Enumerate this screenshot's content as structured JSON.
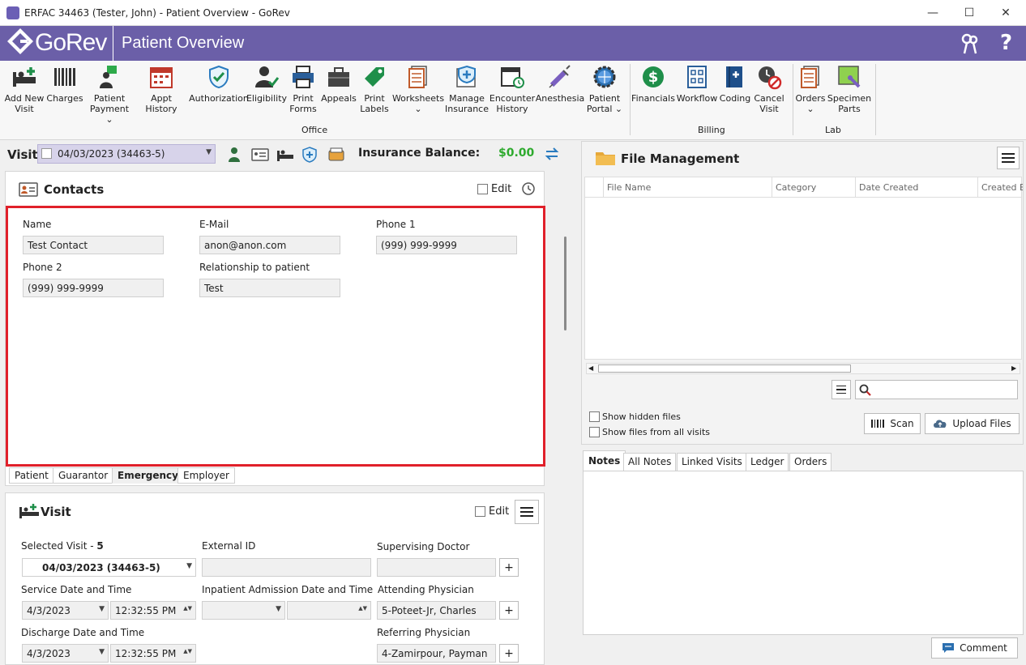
{
  "window": {
    "title": "ERFAC 34463 (Tester, John) - Patient Overview - GoRev",
    "minimize": "—",
    "maximize": "☐",
    "close": "✕"
  },
  "appbar": {
    "logo_text": "GoRev",
    "page_title": "Patient Overview",
    "keys_icon": "keys-icon",
    "help_icon": "?"
  },
  "ribbon": {
    "office_items": [
      {
        "label": "Add New\nVisit",
        "icon": "add-visit-icon"
      },
      {
        "label": "Charges",
        "icon": "barcode-icon"
      },
      {
        "label": "Patient\nPayment ⌄",
        "icon": "payment-icon"
      },
      {
        "label": "Appt History",
        "icon": "calendar-icon"
      },
      {
        "label": "Authorization",
        "icon": "shield-check-icon"
      },
      {
        "label": "Eligibility",
        "icon": "person-check-icon"
      },
      {
        "label": "Print\nForms",
        "icon": "printer-icon"
      },
      {
        "label": "Appeals",
        "icon": "briefcase-icon"
      },
      {
        "label": "Print\nLabels",
        "icon": "tag-icon"
      },
      {
        "label": "Worksheets\n⌄",
        "icon": "worksheets-icon"
      },
      {
        "label": "Manage\nInsurance",
        "icon": "insurance-icon"
      },
      {
        "label": "Encounter\nHistory",
        "icon": "encounter-icon"
      },
      {
        "label": "Anesthesia",
        "icon": "syringe-icon"
      },
      {
        "label": "Patient\nPortal ⌄",
        "icon": "globe-gear-icon"
      }
    ],
    "billing_items": [
      {
        "label": "Financials",
        "icon": "dollar-icon"
      },
      {
        "label": "Workflow",
        "icon": "workflow-icon"
      },
      {
        "label": "Coding",
        "icon": "coding-book-icon"
      },
      {
        "label": "Cancel\nVisit",
        "icon": "cancel-visit-icon"
      }
    ],
    "lab_items": [
      {
        "label": "Orders\n⌄",
        "icon": "orders-icon"
      },
      {
        "label": "Specimen\nParts",
        "icon": "specimen-icon"
      }
    ],
    "group_office": "Office",
    "group_billing": "Billing",
    "group_lab": "Lab"
  },
  "visitbar": {
    "label": "Visit",
    "selected": "04/03/2023 (34463-5)",
    "insurance_balance_label": "Insurance Balance:",
    "insurance_balance_value": "$0.00"
  },
  "contacts": {
    "title": "Contacts",
    "edit_label": "Edit",
    "name_label": "Name",
    "name_value": "Test Contact",
    "email_label": "E-Mail",
    "email_value": "anon@anon.com",
    "phone1_label": "Phone 1",
    "phone1_value": "(999) 999-9999",
    "phone2_label": "Phone 2",
    "phone2_value": "(999) 999-9999",
    "relationship_label": "Relationship to patient",
    "relationship_value": "Test",
    "tabs": [
      "Patient",
      "Guarantor",
      "Emergency",
      "Employer"
    ]
  },
  "visit": {
    "title": "Visit",
    "edit_label": "Edit",
    "selected_visit_label": "Selected Visit -",
    "selected_visit_num": "5",
    "selected_visit_value": "04/03/2023 (34463-5)",
    "external_id_label": "External ID",
    "supervising_doctor_label": "Supervising Doctor",
    "service_datetime_label": "Service Date and Time",
    "service_date": "4/3/2023",
    "service_time": "12:32:55 PM",
    "inpatient_label": "Inpatient Admission Date and Time",
    "attending_label": "Attending Physician",
    "attending_value": "5-Poteet-Jr, Charles",
    "discharge_label": "Discharge Date and Time",
    "discharge_date": "4/3/2023",
    "discharge_time": "12:32:55 PM",
    "referring_label": "Referring Physician",
    "referring_value": "4-Zamirpour, Payman"
  },
  "files": {
    "title": "File Management",
    "columns": [
      "File Name",
      "Category",
      "Date Created",
      "Created B"
    ],
    "show_hidden": "Show hidden files",
    "show_all_visits": "Show files from all visits",
    "scan_label": "Scan",
    "upload_label": "Upload Files"
  },
  "notes": {
    "tabs": [
      "Notes",
      "All Notes",
      "Linked Visits",
      "Ledger",
      "Orders"
    ],
    "comment_label": "Comment"
  },
  "colors": {
    "appbar": "#6b5fa8",
    "highlight": "#e0202a",
    "balance_green": "#2eaa2e",
    "icon_green": "#1f8f4a",
    "icon_dark": "#3a3a3a"
  }
}
